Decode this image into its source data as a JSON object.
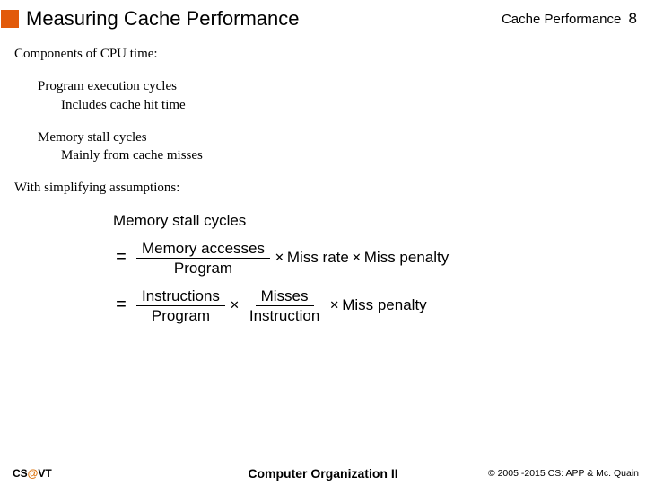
{
  "header": {
    "title": "Measuring Cache Performance",
    "section": "Cache Performance",
    "page": "8"
  },
  "content": {
    "components_heading": "Components of CPU time:",
    "item1_main": "Program execution cycles",
    "item1_sub": "Includes cache hit time",
    "item2_main": "Memory stall cycles",
    "item2_sub": "Mainly from cache misses",
    "assumptions": "With simplifying assumptions:"
  },
  "equation": {
    "lhs": "Memory stall cycles",
    "line2_frac_num": "Memory accesses",
    "line2_frac_den": "Program",
    "miss_rate": "Miss rate",
    "miss_penalty": "Miss penalty",
    "line3_frac1_num": "Instructions",
    "line3_frac1_den": "Program",
    "line3_frac2_num": "Misses",
    "line3_frac2_den": "Instruction"
  },
  "footer": {
    "left_cs": "CS",
    "left_at": "@",
    "left_vt": "VT",
    "center": "Computer Organization II",
    "right": "© 2005 -2015 CS: APP & Mc. Quain"
  }
}
